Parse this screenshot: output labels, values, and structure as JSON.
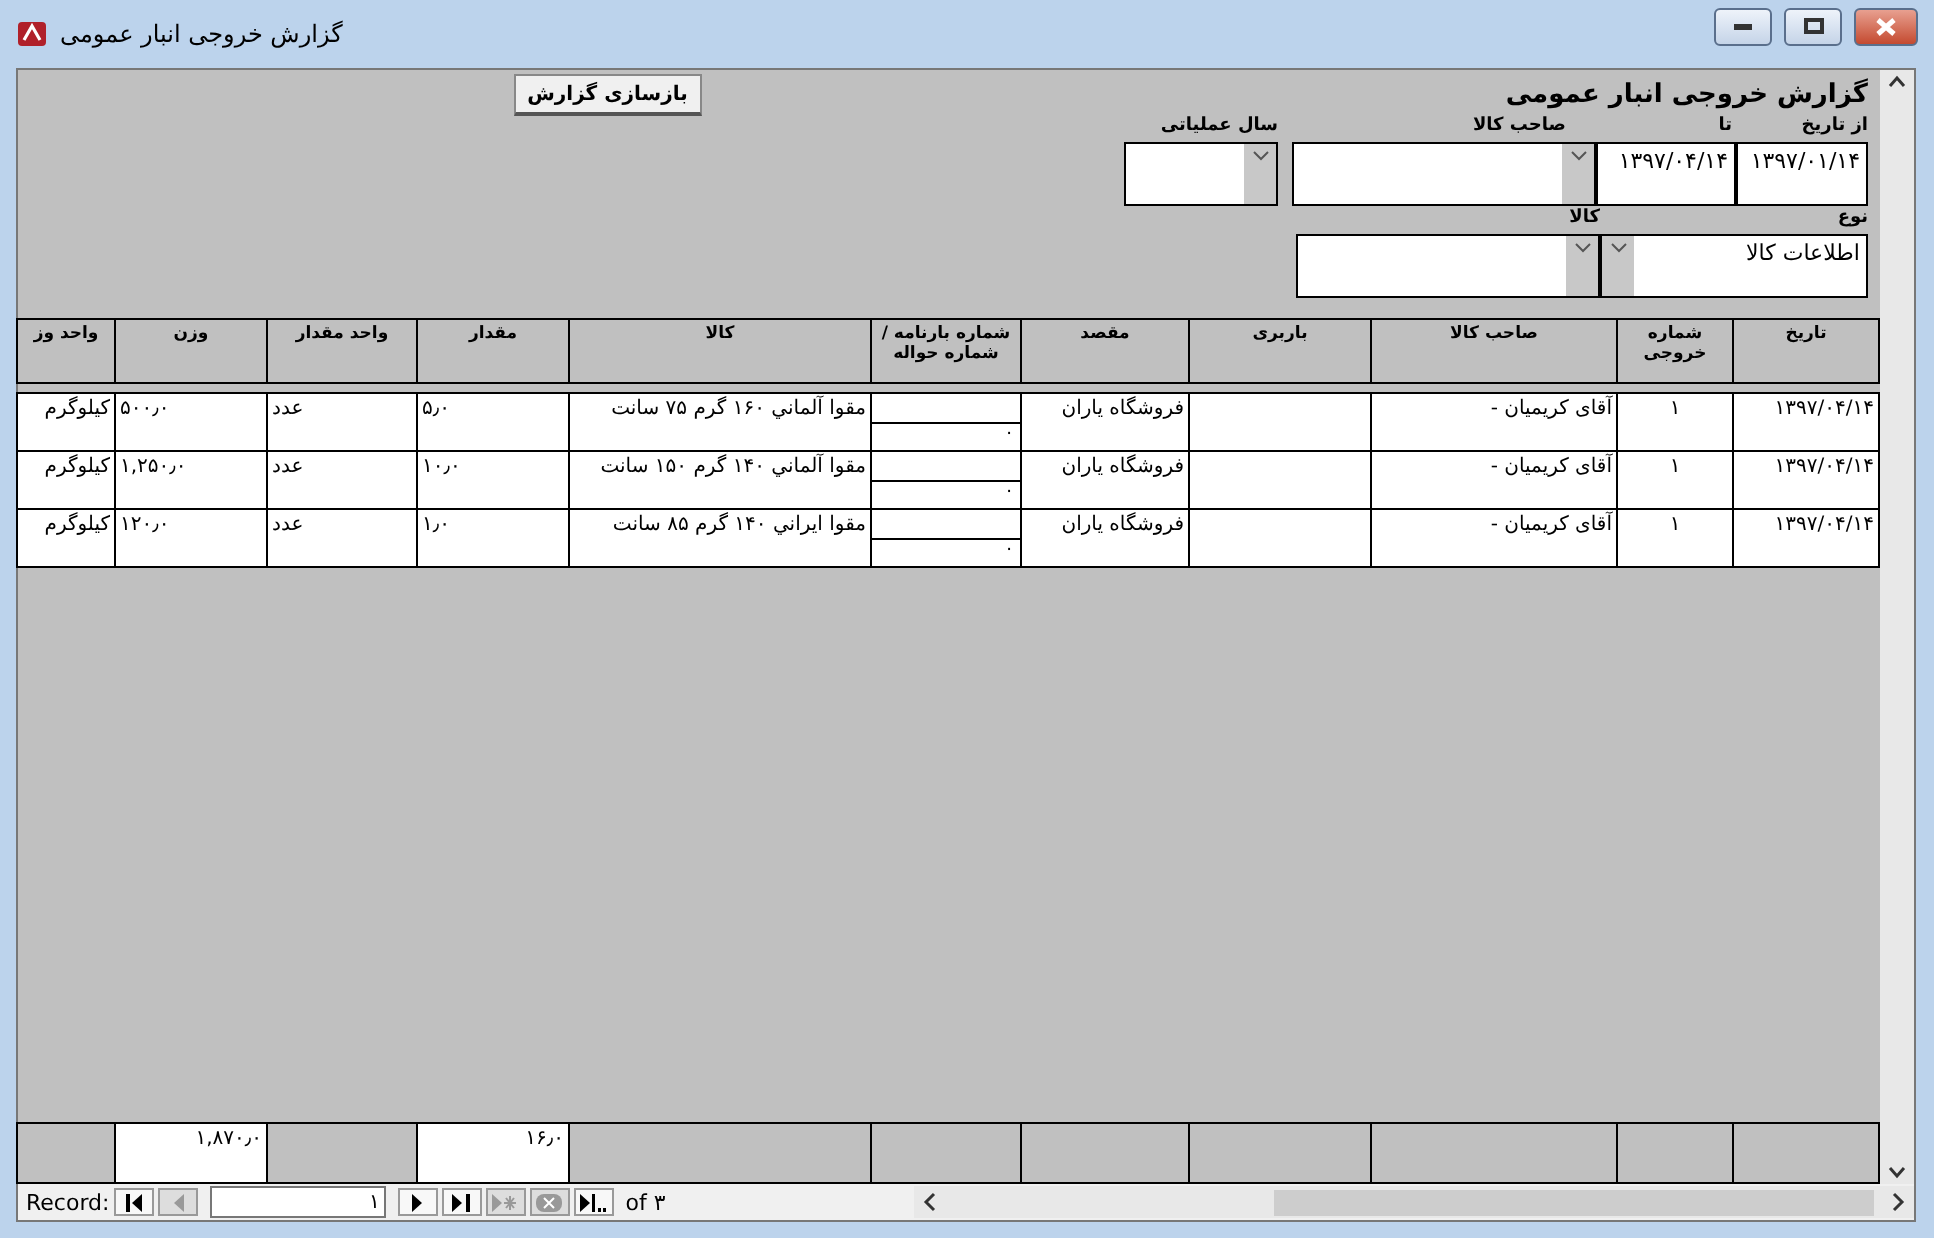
{
  "window": {
    "title": "گزارش خروجی انبار عمومی"
  },
  "form": {
    "title": "گزارش خروجی انبار عمومی",
    "rebuild_button": "بازسازی گزارش",
    "filters": [
      {
        "label": "از تاریخ",
        "kind": "text",
        "value": "۱۳۹۷/۰۱/۱۴"
      },
      {
        "label": "تا",
        "kind": "text",
        "value": "۱۳۹۷/۰۴/۱۴"
      },
      {
        "label": "صاحب کالا",
        "kind": "combo"
      },
      {
        "label": "سال عملیاتی",
        "kind": "combo"
      },
      {
        "label": "نوع",
        "kind": "combo",
        "value": "اطلاعات کالا"
      },
      {
        "label": "کالا",
        "kind": "combo"
      }
    ]
  },
  "table": {
    "columns": [
      "تاریخ",
      "شماره خروجی",
      "صاحب کالا",
      "باربری",
      "مقصد",
      "شماره بارنامه / شماره حواله",
      "کالا",
      "مقدار",
      "واحد مقدار",
      "وزن",
      "واحد وز"
    ],
    "rows": [
      {
        "date": "۱۳۹۷/۰۴/۱۴",
        "exit_number": "۱",
        "owner": "آقای کریمیان -",
        "destination": "فروشگاه یاران",
        "bill_number": "۰",
        "item": "مقوا آلماني ۱۶۰ گرم ۷۵ سانت",
        "quantity": "۵٫۰",
        "quantity_unit": "عدد",
        "weight": "۵۰۰٫۰",
        "weight_unit": "کیلوگرم"
      },
      {
        "date": "۱۳۹۷/۰۴/۱۴",
        "exit_number": "۱",
        "owner": "آقای کریمیان -",
        "destination": "فروشگاه یاران",
        "bill_number": "۰",
        "item": "مقوا آلماني ۱۴۰ گرم ۱۵۰ سانت",
        "quantity": "۱۰٫۰",
        "quantity_unit": "عدد",
        "weight": "۱,۲۵۰٫۰",
        "weight_unit": "کیلوگرم"
      },
      {
        "date": "۱۳۹۷/۰۴/۱۴",
        "exit_number": "۱",
        "owner": "آقای کریمیان -",
        "destination": "فروشگاه یاران",
        "bill_number": "۰",
        "item": "مقوا ایراني ۱۴۰ گرم ۸۵ سانت",
        "quantity": "۱٫۰",
        "quantity_unit": "عدد",
        "weight": "۱۲۰٫۰",
        "weight_unit": "کیلوگرم"
      }
    ],
    "totals": {
      "quantity": "۱۶٫۰",
      "weight": "۱,۸۷۰٫۰"
    }
  },
  "navigation": {
    "label": "Record:",
    "current": "۱",
    "of": "of ۳",
    "buttons": [
      {
        "kind": "first",
        "disabled": false
      },
      {
        "kind": "prev",
        "disabled": true
      },
      {
        "kind": "next",
        "disabled": false
      },
      {
        "kind": "last",
        "disabled": false
      },
      {
        "kind": "new",
        "disabled": true
      },
      {
        "kind": "delete",
        "disabled": true
      },
      {
        "kind": "filter",
        "disabled": false
      }
    ]
  }
}
